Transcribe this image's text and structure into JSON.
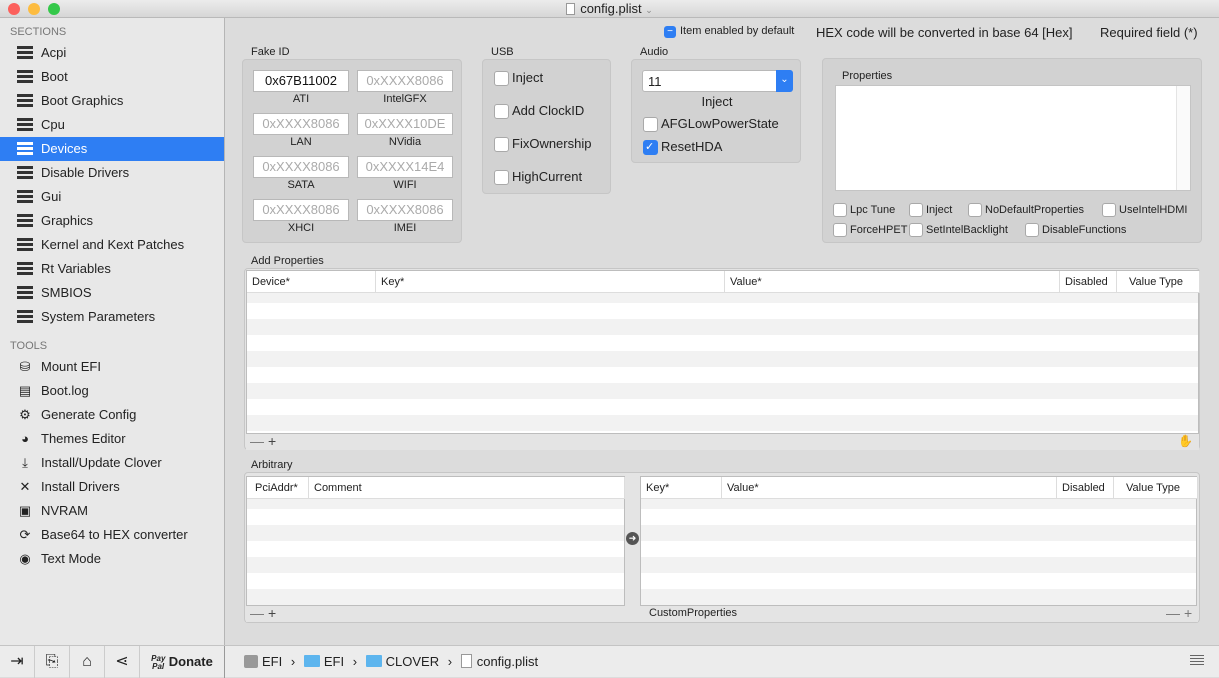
{
  "window": {
    "title": "config.plist"
  },
  "sidebar": {
    "sections_header": "SECTIONS",
    "sections": [
      "Acpi",
      "Boot",
      "Boot Graphics",
      "Cpu",
      "Devices",
      "Disable Drivers",
      "Gui",
      "Graphics",
      "Kernel and Kext Patches",
      "Rt Variables",
      "SMBIOS",
      "System Parameters"
    ],
    "selected": "Devices",
    "tools_header": "TOOLS",
    "tools": [
      {
        "label": "Mount EFI",
        "icon": "disk-icon"
      },
      {
        "label": "Boot.log",
        "icon": "log-icon"
      },
      {
        "label": "Generate Config",
        "icon": "gears-icon"
      },
      {
        "label": "Themes Editor",
        "icon": "palette-icon"
      },
      {
        "label": "Install/Update Clover",
        "icon": "download-icon"
      },
      {
        "label": "Install Drivers",
        "icon": "wrench-icon"
      },
      {
        "label": "NVRAM",
        "icon": "chip-icon"
      },
      {
        "label": "Base64 to HEX converter",
        "icon": "refresh-icon"
      },
      {
        "label": "Text Mode",
        "icon": "eye-icon"
      }
    ]
  },
  "header": {
    "item_enabled": "Item enabled by default",
    "hex_note": "HEX code will be converted in base 64 [Hex]",
    "required": "Required field (*)"
  },
  "fake_id": {
    "label": "Fake ID",
    "fields": [
      {
        "label": "ATI",
        "value": "0x67B11002",
        "placeholder": "0xXXXX8086"
      },
      {
        "label": "IntelGFX",
        "value": "",
        "placeholder": "0xXXXX8086"
      },
      {
        "label": "LAN",
        "value": "",
        "placeholder": "0xXXXX8086"
      },
      {
        "label": "NVidia",
        "value": "",
        "placeholder": "0xXXXX10DE"
      },
      {
        "label": "SATA",
        "value": "",
        "placeholder": "0xXXXX8086"
      },
      {
        "label": "WIFI",
        "value": "",
        "placeholder": "0xXXXX14E4"
      },
      {
        "label": "XHCI",
        "value": "",
        "placeholder": "0xXXXX8086"
      },
      {
        "label": "IMEI",
        "value": "",
        "placeholder": "0xXXXX8086"
      }
    ]
  },
  "usb": {
    "label": "USB",
    "options": [
      {
        "label": "Inject",
        "checked": false
      },
      {
        "label": "Add ClockID",
        "checked": false
      },
      {
        "label": "FixOwnership",
        "checked": false
      },
      {
        "label": "HighCurrent",
        "checked": false
      }
    ]
  },
  "audio": {
    "label": "Audio",
    "inject_value": "11",
    "inject_label": "Inject",
    "options": [
      {
        "label": "AFGLowPowerState",
        "checked": false
      },
      {
        "label": "ResetHDA",
        "checked": true
      }
    ]
  },
  "properties": {
    "label": "Properties",
    "options": [
      {
        "label": "Lpc Tune",
        "checked": false
      },
      {
        "label": "Inject",
        "checked": false
      },
      {
        "label": "NoDefaultProperties",
        "checked": false
      },
      {
        "label": "UseIntelHDMI",
        "checked": false
      },
      {
        "label": "ForceHPET",
        "checked": false
      },
      {
        "label": "SetIntelBacklight",
        "checked": false
      },
      {
        "label": "DisableFunctions",
        "checked": false
      }
    ]
  },
  "add_properties": {
    "label": "Add Properties",
    "columns": [
      "Device*",
      "Key*",
      "Value*",
      "Disabled",
      "Value Type"
    ],
    "rows": []
  },
  "arbitrary": {
    "label": "Arbitrary",
    "left_columns": [
      "PciAddr*",
      "Comment"
    ],
    "right_columns": [
      "Key*",
      "Value*",
      "Disabled",
      "Value Type"
    ],
    "custom_label": "CustomProperties"
  },
  "footer": {
    "minus": "—",
    "plus": "+"
  },
  "bottom": {
    "donate": "Donate",
    "paypal": "Pay Pal",
    "path": [
      "EFI",
      "EFI",
      "CLOVER",
      "config.plist"
    ],
    "separator": "›"
  },
  "colors": {
    "accent": "#2e7ef3"
  }
}
